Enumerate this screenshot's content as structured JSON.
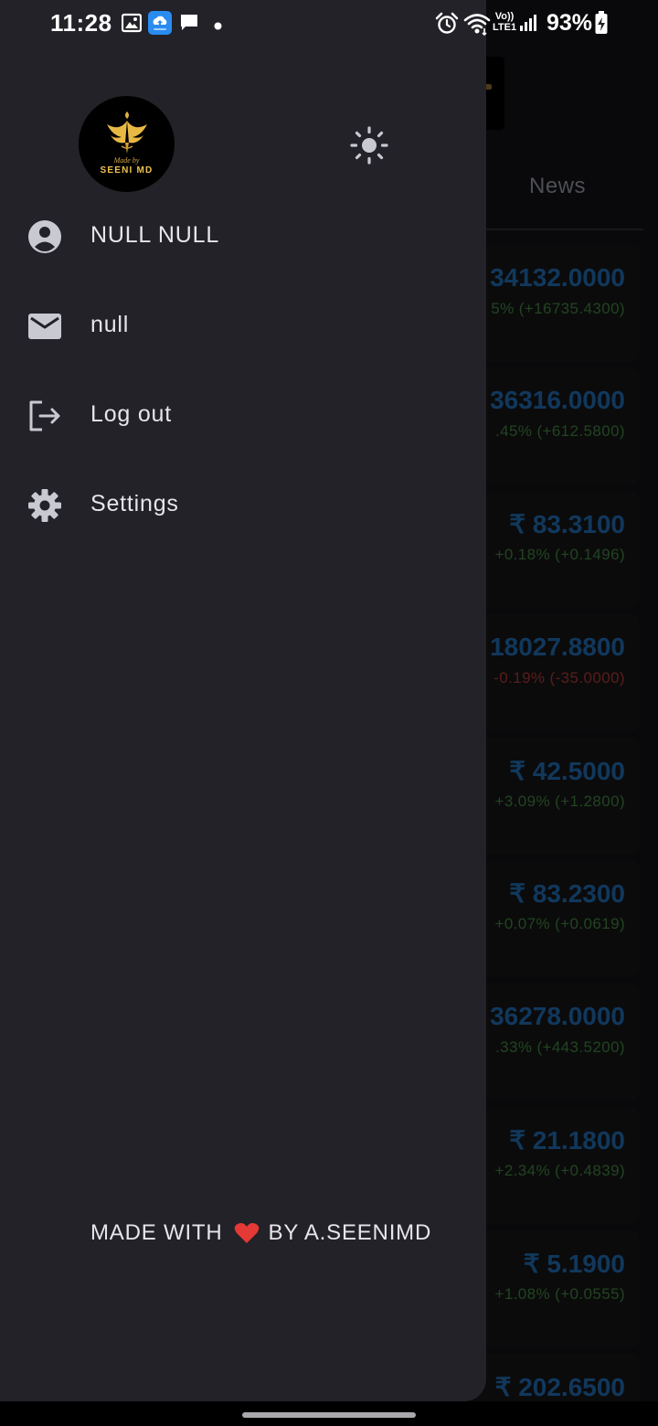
{
  "status_bar": {
    "time": "11:28",
    "battery": "93%",
    "network_label_top": "Vo))",
    "network_label_bottom": "LTE1"
  },
  "background": {
    "tab_label": "News",
    "rows": [
      {
        "price": "34132.0000",
        "change": "5% (+16735.4300)",
        "trend": "up"
      },
      {
        "price": "36316.0000",
        "change": ".45% (+612.5800)",
        "trend": "up"
      },
      {
        "price": "₹ 83.3100",
        "change": "+0.18% (+0.1496)",
        "trend": "up"
      },
      {
        "price": "18027.8800",
        "change": "-0.19% (-35.0000)",
        "trend": "down"
      },
      {
        "price": "₹ 42.5000",
        "change": "+3.09% (+1.2800)",
        "trend": "up"
      },
      {
        "price": "₹ 83.2300",
        "change": "+0.07% (+0.0619)",
        "trend": "up"
      },
      {
        "price": "36278.0000",
        "change": ".33% (+443.5200)",
        "trend": "up"
      },
      {
        "price": "₹ 21.1800",
        "change": "+2.34% (+0.4839)",
        "trend": "up"
      },
      {
        "price": "₹ 5.1900",
        "change": "+1.08% (+0.0555)",
        "trend": "up"
      },
      {
        "price": "₹ 202.6500",
        "change": "",
        "trend": "up"
      }
    ]
  },
  "drawer": {
    "avatar": {
      "made_by": "Made by",
      "brand": "SEENI MD"
    },
    "theme_icon": "sun-icon",
    "items": [
      {
        "label": "NULL NULL",
        "icon": "account-circle-icon"
      },
      {
        "label": "null",
        "icon": "mail-icon"
      },
      {
        "label": "Log out",
        "icon": "logout-icon"
      },
      {
        "label": "Settings",
        "icon": "gear-icon"
      }
    ],
    "footer": {
      "prefix": "MADE WITH",
      "suffix": "BY A.SEENIMD"
    }
  },
  "colors": {
    "drawer_bg": "#222228",
    "price_blue": "#1f67a8",
    "up_green": "#3f7d3c",
    "down_red": "#a5352f",
    "heart_red": "#e53935"
  }
}
